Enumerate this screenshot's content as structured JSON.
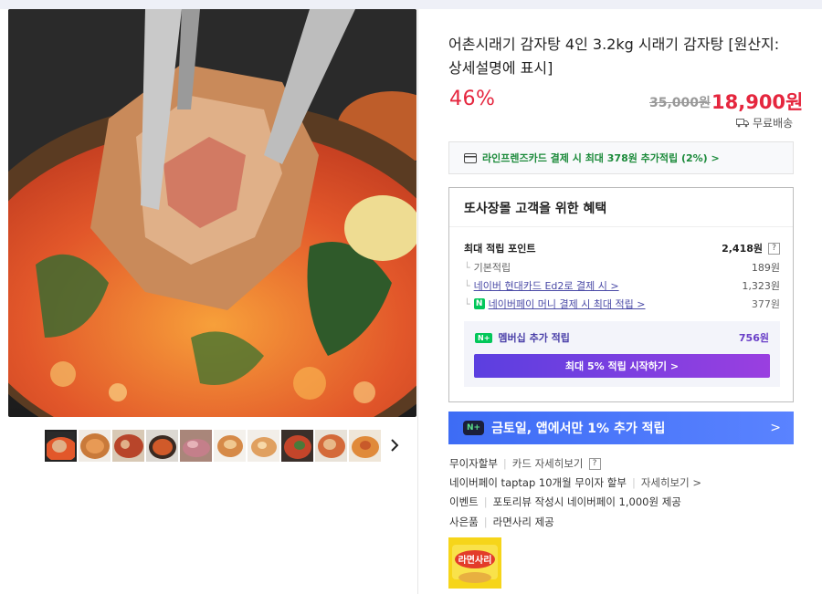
{
  "product": {
    "title": "어촌시래기 감자탕 4인 3.2kg 시래기 감자탕 [원산지: 상세설명에 표시]",
    "discount_rate": "46%",
    "original_price": "35,000원",
    "sale_price": "18,900원",
    "shipping": "무료배송",
    "main_image_icon": "stew-photo",
    "thumbnail_count": 10,
    "active_thumbnail": 1
  },
  "card_offer": {
    "text": "라인프렌즈카드 결제 시 최대 378원 추가적립 (2%) >",
    "icon": "card-icon"
  },
  "benefits": {
    "title": "또사장몰 고객을 위한 혜택",
    "max_points_label": "최대 적립 포인트",
    "max_points_value": "2,418원",
    "help": "?",
    "basic_label": "기본적립",
    "basic_value": "189원",
    "card_label": "네이버 현대카드 Ed2로 결제 시 >",
    "card_value": "1,323원",
    "npay_label": "네이버페이 머니 결제 시 최대 적립 >",
    "npay_value": "377원",
    "npay_badge": "N",
    "member_badge": "N+",
    "member_label": "멤버십 추가 적립",
    "member_value": "756원",
    "member_button": "최대 5% 적립 시작하기 >"
  },
  "promo": {
    "badge": "N+",
    "text": "금토일, 앱에서만 1% 추가 적립",
    "chevron": ">"
  },
  "info": {
    "installment_label": "무이자할부",
    "installment_link": "카드 자세히보기",
    "installment_help": "?",
    "taptap_text": "네이버페이 taptap 10개월 무이자 할부",
    "taptap_link": "자세히보기 >",
    "event_label": "이벤트",
    "event_text": "포토리뷰 작성시 네이버페이 1,000원 제공",
    "gift_label": "사은품",
    "gift_text": "라면사리 제공",
    "gift_image_text": "라면사리"
  },
  "colors": {
    "accent_red": "#e5263e",
    "naver_green": "#03c75a",
    "promo_blue": "#3d6cf5",
    "member_purple": "#6a3fc8"
  }
}
